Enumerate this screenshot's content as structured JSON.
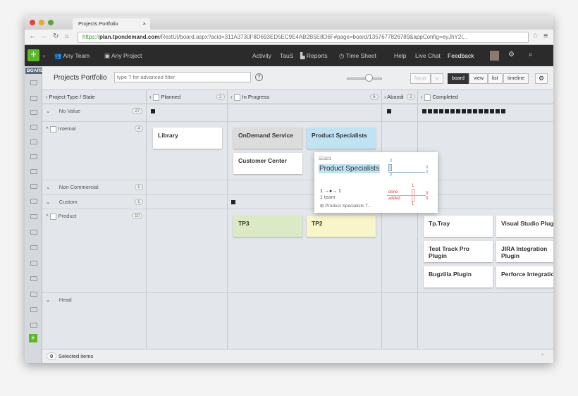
{
  "browser": {
    "tab_title": "Projects Portfolio",
    "url_https": "https://",
    "url_host": "plan.tpondemand.com",
    "url_rest": "/RestUI/board.aspx?acid=311A3730F8D693ED5EC9E4AB2B5E8D6F#page=board/1357677826789&appConfig=eyJhY2I..."
  },
  "nav": {
    "team": "Any Team",
    "project": "Any Project",
    "activity": "Activity",
    "taus": "TauS",
    "reports": "Reports",
    "timesheet": "Time Sheet",
    "help": "Help",
    "livechat": "Live Chat",
    "feedback": "Feedback"
  },
  "sidebar": {
    "label": "BOARD"
  },
  "toolbar": {
    "title": "Projects Portfolio",
    "filter_placeholder": "type ? for advanced filter",
    "focus": "focus",
    "views": [
      "board",
      "view",
      "list",
      "timeline"
    ],
    "active_view": "board"
  },
  "columns": [
    {
      "label": "Project Type / State"
    },
    {
      "label": "Planned",
      "count": "2"
    },
    {
      "label": "In Progress",
      "count": "6"
    },
    {
      "label": "Abandoned",
      "short": "Abandi",
      "count": "2"
    },
    {
      "label": "Completed"
    }
  ],
  "rows": [
    {
      "label": "No Value",
      "count": "27"
    },
    {
      "label": "Internal",
      "count": "4"
    },
    {
      "label": "Non Commercial",
      "count": "1"
    },
    {
      "label": "Custom",
      "count": "1"
    },
    {
      "label": "Product",
      "count": "10"
    },
    {
      "label": "Head"
    }
  ],
  "cards": {
    "library": "Library",
    "ondemand": "OnDemand Service",
    "prodspec": "Product Specialists",
    "custcenter": "Customer Center",
    "tp3": "TP3",
    "tp2": "TP2",
    "tptray": "Tp.Tray",
    "vs": "Visual Studio Plugin",
    "ttp": "Test Track Pro Plugin",
    "jira": "JIRA Integration Plugin",
    "bugzilla": "Bugzilla Plugin",
    "perforce": "Perforce Integration"
  },
  "popup": {
    "id": "55181",
    "title": "Product Specialists",
    "flow": "1 →●→ 1",
    "teams": "1 team",
    "done": "done",
    "added": "added",
    "top": "2",
    "bottom": "2",
    "zero": "0",
    "one": "1",
    "team_name": "Product Specialists T..."
  },
  "footer": {
    "count": "0",
    "label": "Selected items"
  },
  "colors": {
    "accent": "#5cb82a",
    "nav_bg": "#2b2b2b",
    "card_selected": "#bfe3f3",
    "card_gray": "#dcdcdc",
    "card_green": "#dbe9c4",
    "card_yellow": "#f8f5c8"
  }
}
